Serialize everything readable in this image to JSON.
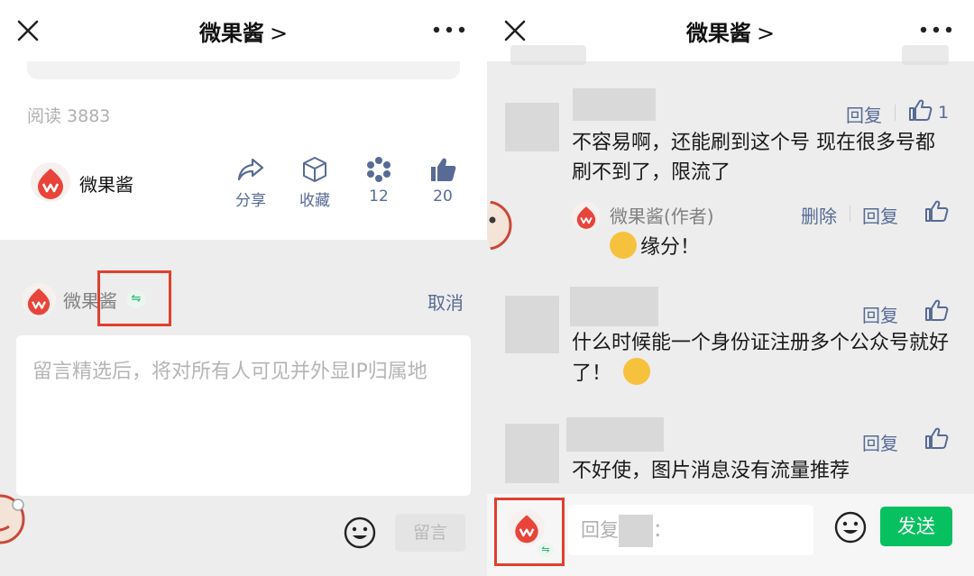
{
  "left": {
    "header": {
      "title": "微果酱",
      "chevron": ">",
      "menu": "•••"
    },
    "article": {
      "read_count": "阅读 3883",
      "author": "微果酱"
    },
    "actions": [
      {
        "icon": "share-icon",
        "label": "分享"
      },
      {
        "icon": "bookmark-box-icon",
        "label": "收藏"
      },
      {
        "icon": "wow-icon",
        "label": "12"
      },
      {
        "icon": "thumbs-up-icon",
        "label": "20"
      }
    ],
    "compose": {
      "name": "微果酱",
      "swap_glyph": "⇋",
      "cancel": "取消",
      "placeholder": "留言精选后，将对所有人可见并外显IP归属地",
      "submit": "留言"
    }
  },
  "right": {
    "header": {
      "title": "微果酱",
      "chevron": ">",
      "menu": "•••"
    },
    "comments": [
      {
        "reply": "回复",
        "likes": "1",
        "text": "不容易啊，还能刷到这个号 现在很多号都刷不到了，限流了",
        "author_reply": {
          "name": "微果酱(作者)",
          "delete": "删除",
          "reply": "回复",
          "text": "缘分！"
        }
      },
      {
        "reply": "回复",
        "text": "什么时候能一个身份证注册多个公众号就好了！"
      },
      {
        "reply": "回复",
        "text": "不好使，图片消息没有流量推荐"
      }
    ],
    "reply_bar": {
      "prefix": "回复",
      "suffix": "：",
      "send": "发送",
      "swap_glyph": "⇋"
    }
  },
  "colors": {
    "link": "#576b95",
    "send_green": "#07c160",
    "highlight_red": "#e0402e",
    "brand_red": "#e8443a"
  }
}
